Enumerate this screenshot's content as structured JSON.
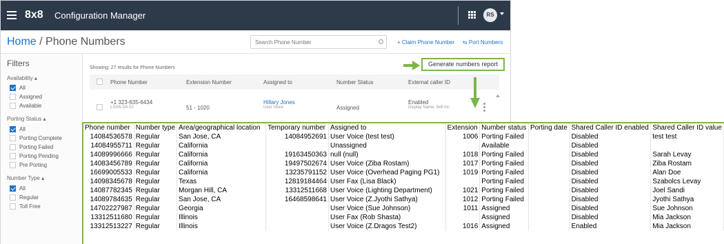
{
  "topbar": {
    "brand": "8x8",
    "title": "Configuration Manager",
    "avatar_initials": "RS"
  },
  "header": {
    "home": "Home",
    "separator": " / ",
    "page": "Phone Numbers",
    "search_placeholder": "Search Phone Number",
    "claim_label": "+ Claim Phone Number",
    "port_label": "⇆ Port Numbers"
  },
  "filters": {
    "title": "Filters",
    "availability": {
      "label": "Availability ▴",
      "items": [
        "All",
        "Assigned",
        "Available"
      ]
    },
    "porting_status": {
      "label": "Porting Status ▴",
      "items": [
        "All",
        "Porting Complete",
        "Porting Failed",
        "Porting Pending",
        "Pre Porting"
      ]
    },
    "number_type": {
      "label": "Number Type ▴",
      "items": [
        "All",
        "Regular",
        "Toll Free"
      ]
    }
  },
  "list": {
    "showing": "Showing: 27 results for Phone Numbers",
    "report_button": "Generate numbers report",
    "columns": [
      "Phone Number",
      "Extension Number",
      "Assigned to",
      "Number Status",
      "External caller ID"
    ],
    "row": {
      "phone": "+1 323-635-6434",
      "phone_sub": "LSAN DA 02",
      "extension": "51 - 1020",
      "assigned": "Hillary Jones",
      "assigned_sub": "User Voice",
      "status": "Assigned",
      "caller": "Enabled",
      "caller_sub": "Display Name: 8x8 Inc"
    }
  },
  "sheet": {
    "headers": [
      "Phone number",
      "Number type",
      "Area/geographical location",
      "Temporary number",
      "Assigned to",
      "Extension",
      "Number status",
      "Porting date",
      "Shared Caller ID enabled",
      "Shared Caller ID value"
    ],
    "rows": [
      [
        "14084536578",
        "Regular",
        "San Jose, CA",
        "14084952691",
        "User Voice (test test)",
        "1006",
        "Porting Failed",
        "",
        "Disabled",
        "test test"
      ],
      [
        "14084955711",
        "Regular",
        "California",
        "",
        "Unassigned",
        "",
        "Available",
        "",
        "Disabled",
        ""
      ],
      [
        "14089996666",
        "Regular",
        "California",
        "19163450363",
        "null (null)",
        "1018",
        "Porting Failed",
        "",
        "Disabled",
        "Sarah Levay"
      ],
      [
        "14083456789",
        "Regular",
        "California",
        "19497502674",
        "User Voice (Ziba Rostam)",
        "1017",
        "Porting Failed",
        "",
        "Disabled",
        "Ziba Rostam"
      ],
      [
        "16699005533",
        "Regular",
        "California",
        "13235791152",
        "User Voice (Overhead Paging PG1)",
        "1019",
        "Porting Failed",
        "",
        "Disabled",
        "Alan Doe"
      ],
      [
        "14098345678",
        "Regular",
        "Texas",
        "12819184464",
        "User Fax (Lisa Black)",
        "",
        "Porting Failed",
        "",
        "Disabled",
        "Szabolcs Levay"
      ],
      [
        "14087782345",
        "Regular",
        "Morgan Hill, CA",
        "13312511668",
        "User Voice (Lighting Department)",
        "1021",
        "Porting Failed",
        "",
        "Disabled",
        "Joel Sandi"
      ],
      [
        "14089784635",
        "Regular",
        "San Jose, CA",
        "16468598641",
        "User Voice (Z.Jyothi Sathya)",
        "1012",
        "Porting Failed",
        "",
        "Disabled",
        "Jyothi Sathya"
      ],
      [
        "14702227987",
        "Regular",
        "Georgia",
        "",
        "User Voice (Sue Johnson)",
        "1011",
        "Assigned",
        "",
        "Disabled",
        "Sue Johnson"
      ],
      [
        "13312511680",
        "Regular",
        "Illinois",
        "",
        "User Fax (Rob Shasta)",
        "",
        "Assigned",
        "",
        "Disabled",
        "Mia Jackson"
      ],
      [
        "13312513227",
        "Regular",
        "Illinois",
        "",
        "User Voice (Z.Dragos Test2)",
        "1016",
        "Assigned",
        "",
        "Enabled",
        "Mia Jackson"
      ]
    ]
  },
  "colors": {
    "topbar": "#2d3a4a",
    "accent": "#1a73c7",
    "highlight": "#7ab648"
  }
}
